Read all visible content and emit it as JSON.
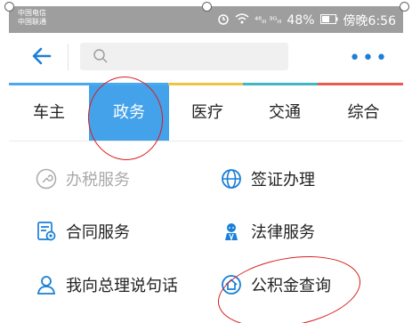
{
  "status_bar": {
    "carriers": [
      "中国电信",
      "中国联通"
    ],
    "signal_text": "⁴⁶ᵢₗₗ ³ᴳᵢₗₗ",
    "battery": "48%",
    "time": "傍晚6:56"
  },
  "search": {
    "placeholder": ""
  },
  "more_label": "•••",
  "tabs": [
    {
      "label": "车主"
    },
    {
      "label": "政务"
    },
    {
      "label": "医疗"
    },
    {
      "label": "交通"
    },
    {
      "label": "综合"
    }
  ],
  "active_tab": "政务",
  "services": [
    {
      "label": "办税服务",
      "enabled": false
    },
    {
      "label": "签证办理",
      "enabled": true
    },
    {
      "label": "合同服务",
      "enabled": true
    },
    {
      "label": "法律服务",
      "enabled": true
    },
    {
      "label": "我向总理说句话",
      "enabled": true
    },
    {
      "label": "公积金查询",
      "enabled": true
    }
  ],
  "colors": {
    "accent": "#43a2ea",
    "icon_blue": "#1a7fd6",
    "strip_blue": "#4aa8ee",
    "strip_yellow": "#f2c241",
    "strip_teal": "#3fb7c4",
    "strip_red": "#ea5a4e",
    "annotation_red": "#d81e1e"
  }
}
